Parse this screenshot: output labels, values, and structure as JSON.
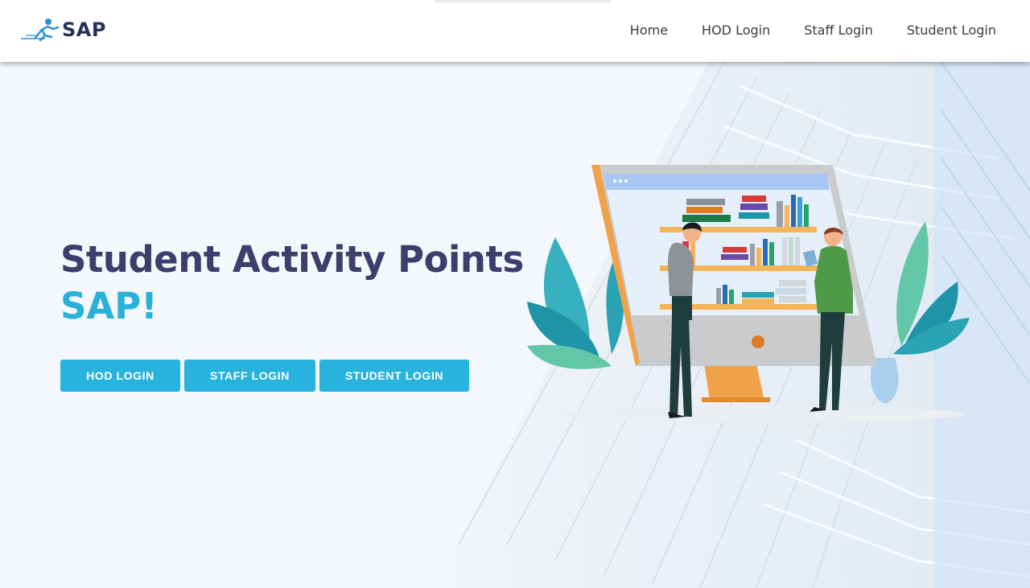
{
  "brand": {
    "name": "SAP"
  },
  "nav": {
    "home": "Home",
    "hod_login": "HOD Login",
    "staff_login": "Staff Login",
    "student_login": "Student Login"
  },
  "hero": {
    "title": "Student Activity Points",
    "subtitle": "SAP!",
    "buttons": {
      "hod": "HOD LOGIN",
      "staff": "STAFF LOGIN",
      "student": "STUDENT LOGIN"
    }
  },
  "colors": {
    "accent": "#28b3df",
    "title": "#3f3d6b",
    "subtitle": "#28b1d9",
    "brand_text": "#23325a"
  },
  "icons": {
    "brand": "runner-logo-icon",
    "illustration": "library-monitor-illustration"
  }
}
